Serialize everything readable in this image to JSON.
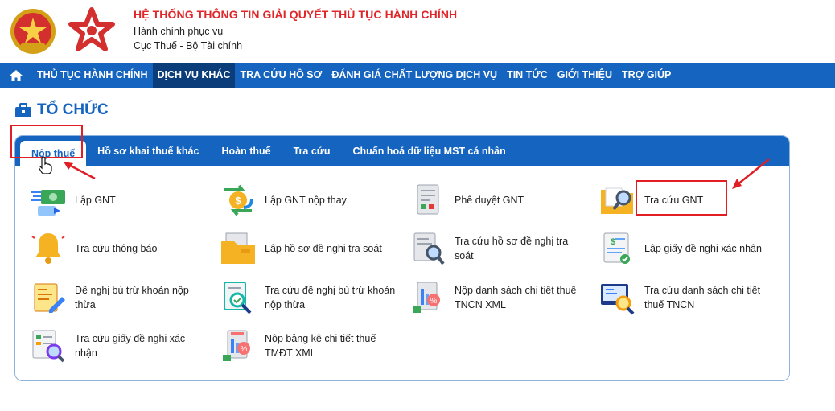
{
  "header": {
    "system_title": "HỆ THỐNG THÔNG TIN GIẢI QUYẾT THỦ TỤC HÀNH CHÍNH",
    "subtitle": "Hành chính phục vụ",
    "agency": "Cục Thuế - Bộ Tài chính"
  },
  "nav": {
    "items": [
      {
        "label": "THỦ TỤC HÀNH CHÍNH"
      },
      {
        "label": "DỊCH VỤ KHÁC",
        "active": true
      },
      {
        "label": "TRA CỨU HỒ SƠ"
      },
      {
        "label": "ĐÁNH GIÁ CHẤT LƯỢNG DỊCH VỤ"
      },
      {
        "label": "TIN TỨC"
      },
      {
        "label": "GIỚI THIỆU"
      },
      {
        "label": "TRỢ GIÚP"
      }
    ]
  },
  "section": {
    "title": "TỔ CHỨC"
  },
  "tabs": [
    {
      "label": "Nộp thuế",
      "active": true
    },
    {
      "label": "Hồ sơ khai thuế khác"
    },
    {
      "label": "Hoàn thuế"
    },
    {
      "label": "Tra cứu"
    },
    {
      "label": "Chuẩn hoá dữ liệu MST cá nhân"
    }
  ],
  "services": [
    {
      "label": "Lập GNT",
      "icon": "money-transfer-icon"
    },
    {
      "label": "Lập GNT nộp thay",
      "icon": "money-exchange-icon"
    },
    {
      "label": "Phê duyệt GNT",
      "icon": "document-approve-icon"
    },
    {
      "label": "Tra cứu GNT",
      "icon": "folder-search-icon"
    },
    {
      "label": "Tra cứu thông báo",
      "icon": "bell-icon"
    },
    {
      "label": "Lập hồ sơ đề nghị tra soát",
      "icon": "folder-icon"
    },
    {
      "label": "Tra cứu hồ sơ đề nghị tra soát",
      "icon": "document-search-icon"
    },
    {
      "label": "Lập giấy đề nghị xác nhận",
      "icon": "certificate-icon"
    },
    {
      "label": "Đề nghị bù trừ khoản nộp thừa",
      "icon": "document-edit-icon"
    },
    {
      "label": "Tra cứu đề nghị bù trừ khoản nộp thừa",
      "icon": "document-check-search-icon"
    },
    {
      "label": "Nộp danh sách chi tiết thuế TNCN XML",
      "icon": "tax-document-icon"
    },
    {
      "label": "Tra cứu danh sách chi tiết thuế TNCN",
      "icon": "screen-search-icon"
    },
    {
      "label": "Tra cứu giấy đề nghị xác nhận",
      "icon": "form-search-icon"
    },
    {
      "label": "Nộp bảng kê chi tiết thuế TMĐT XML",
      "icon": "tax-chart-icon"
    }
  ],
  "colors": {
    "brand_blue": "#1565c0",
    "title_red": "#e1262a",
    "highlight_red": "#e01e24",
    "active_nav": "#0b3d7a"
  }
}
